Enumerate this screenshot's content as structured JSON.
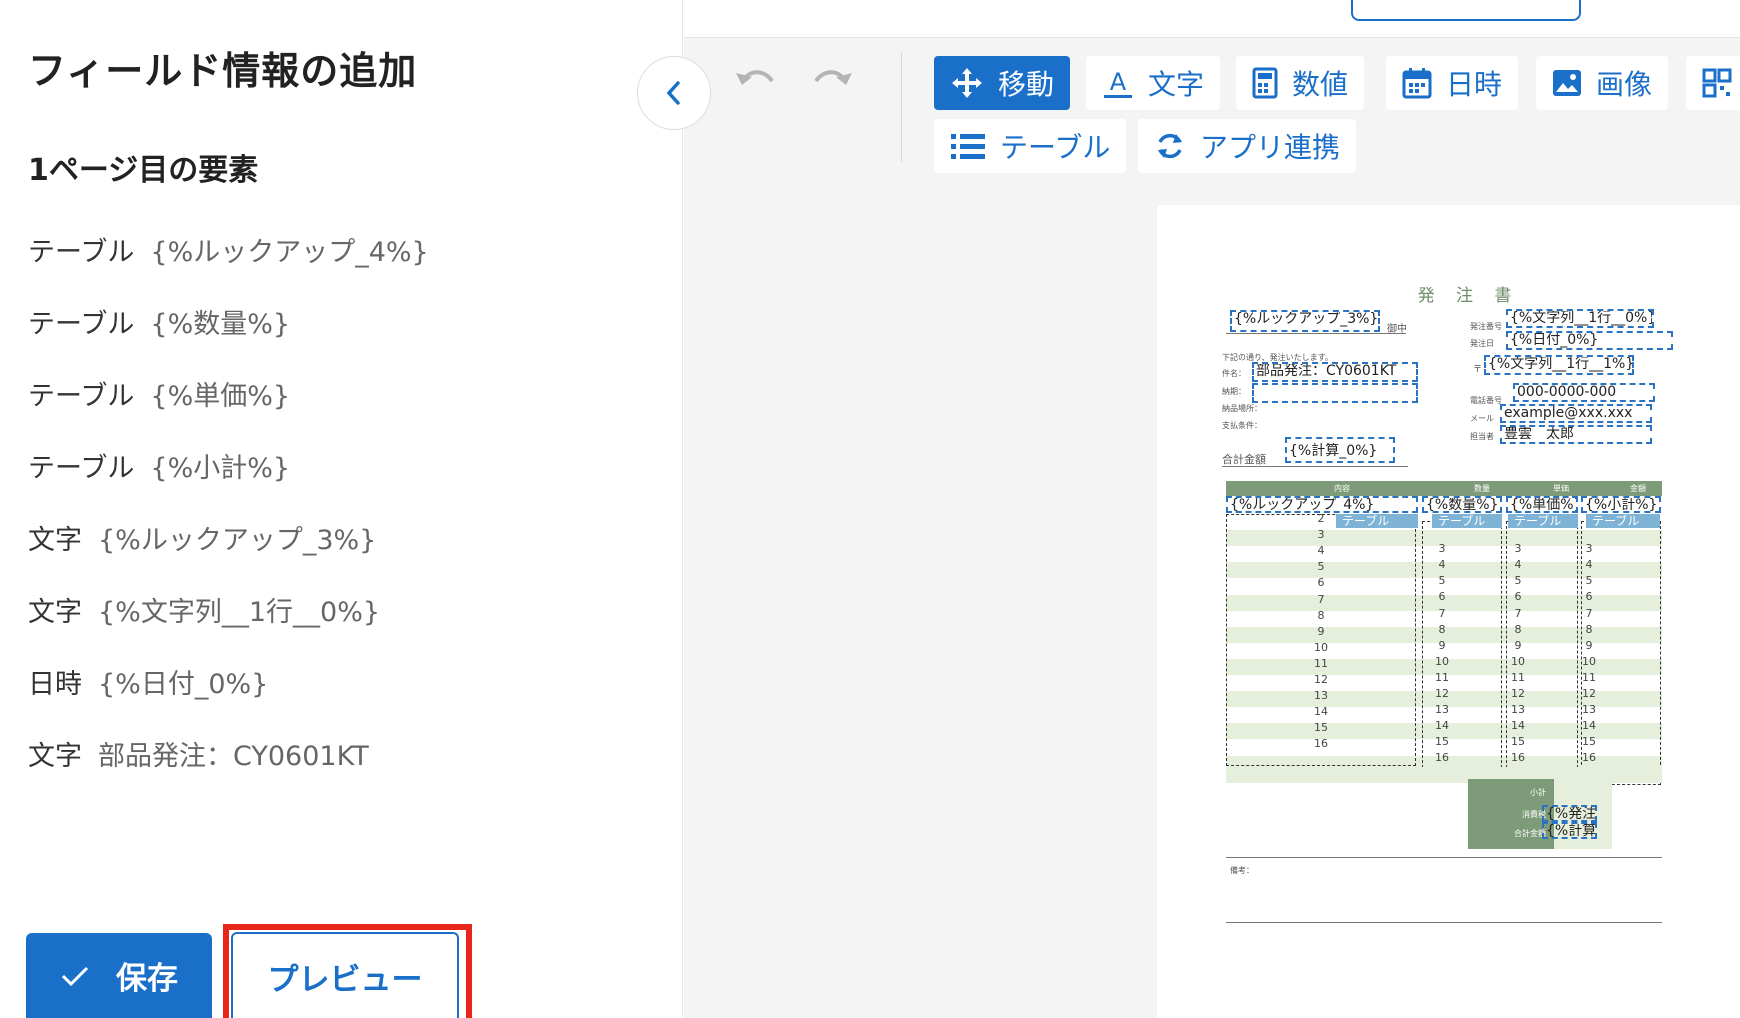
{
  "left_panel": {
    "title": "フィールド情報の追加",
    "subtitle": "1ページ目の要素",
    "items": [
      {
        "type": "テーブル",
        "name": "{%ルックアップ_4%}"
      },
      {
        "type": "テーブル",
        "name": "{%数量%}"
      },
      {
        "type": "テーブル",
        "name": "{%単価%}"
      },
      {
        "type": "テーブル",
        "name": "{%小計%}"
      },
      {
        "type": "文字",
        "name": "{%ルックアップ_3%}"
      },
      {
        "type": "文字",
        "name": "{%文字列__1行__0%}"
      },
      {
        "type": "日時",
        "name": "{%日付_0%}"
      },
      {
        "type": "文字",
        "name": "部品発注：CY0601KT"
      }
    ],
    "save_label": "保存",
    "preview_label": "プレビュー"
  },
  "toolbar": {
    "tools": [
      {
        "label": "移動",
        "icon": "move-icon",
        "active": true
      },
      {
        "label": "文字",
        "icon": "text-icon",
        "active": false
      },
      {
        "label": "数値",
        "icon": "calculator-icon",
        "active": false
      },
      {
        "label": "日時",
        "icon": "calendar-icon",
        "active": false
      },
      {
        "label": "画像",
        "icon": "image-icon",
        "active": false
      },
      {
        "label": "",
        "icon": "qrcode-icon",
        "active": false
      },
      {
        "label": "テーブル",
        "icon": "list-icon",
        "active": false
      },
      {
        "label": "アプリ連携",
        "icon": "sync-icon",
        "active": false
      }
    ]
  },
  "document": {
    "title": "発 注 書",
    "lookup3": "{%ルックアップ_3%}",
    "onchu": "御中",
    "order_no_label": "発注番号",
    "order_no": "{%文字列__1行__0%}",
    "order_date_label": "発注日",
    "order_date": "{%日付_0%}",
    "postal_mark": "〒",
    "addr": "{%文字列__1行__1%}",
    "intro": "下記の通り、発注いたします。",
    "subject_label": "件名：",
    "subject": "部品発注：CY0601KT",
    "deadline_label": "納期：",
    "place_label": "納品場所：",
    "payment_label": "支払条件：",
    "phone_label": "電話番号",
    "phone": "000-0000-000",
    "mail_label": "メール",
    "mail": "example@xxx.xxx",
    "person_label": "担当者",
    "person": "豊雲　太郎",
    "total_label": "合計金額",
    "total": "{%計算_0%}",
    "th_content": "内容",
    "th_qty": "数量",
    "th_unit": "単価",
    "th_amount": "金額",
    "col_lookup": "{%ルックアップ_4%}",
    "col_qty": "{%数量%}",
    "col_unit": "{%単価%}",
    "col_sub": "{%小計%}",
    "table_tag": "テーブル",
    "subtotal_label": "小計",
    "tax_label": "消費税",
    "grand_label": "合計金額",
    "tax_value": "{%発注",
    "grand_value": "{%計算",
    "remarks_label": "備考："
  }
}
